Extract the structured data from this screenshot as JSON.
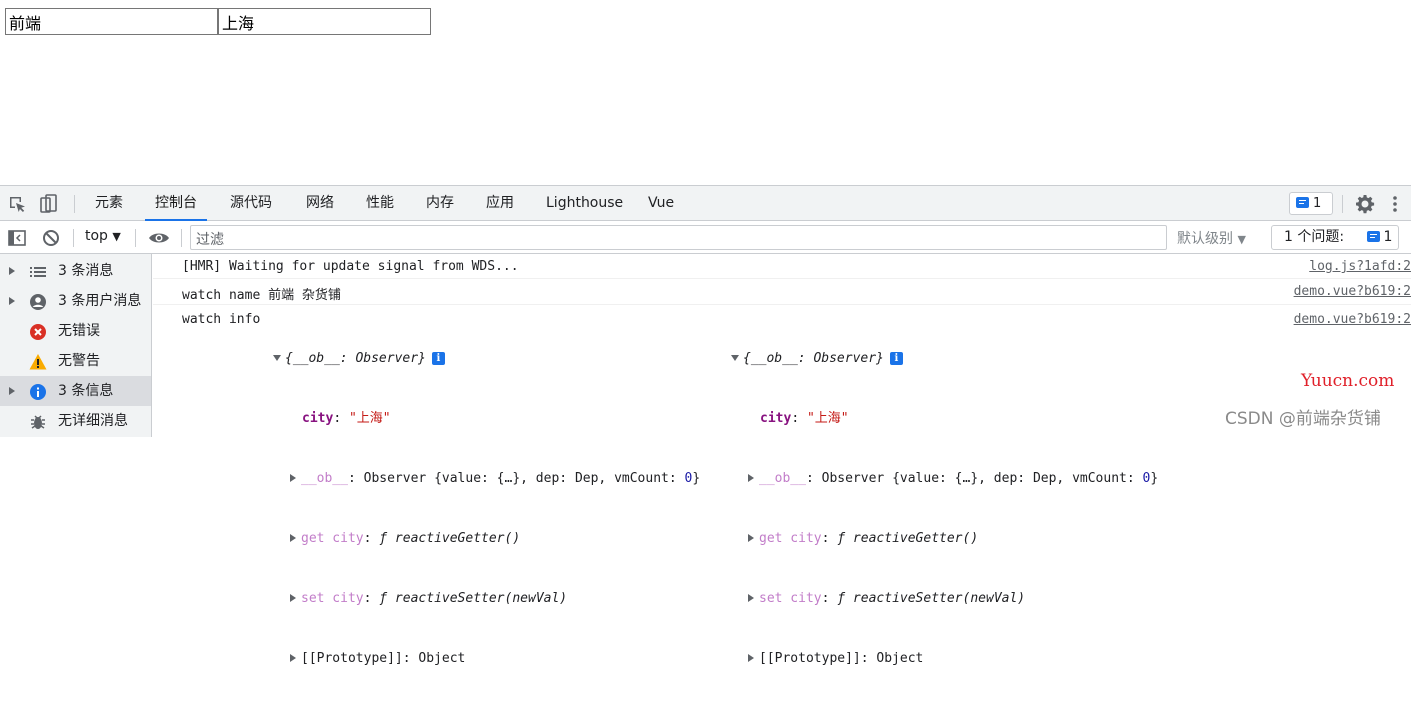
{
  "page": {
    "input1_value": "前端",
    "input2_value": "上海"
  },
  "devtools": {
    "tabs": [
      "元素",
      "控制台",
      "源代码",
      "网络",
      "性能",
      "内存",
      "应用",
      "Lighthouse",
      "Vue"
    ],
    "active_tab": "控制台",
    "issues_badge_count": "1",
    "context": "top",
    "filter_placeholder": "过滤",
    "levels_label": "默认级别",
    "issues_label": "1 个问题:",
    "issues_count": "1"
  },
  "sidebar": {
    "items": [
      {
        "label": "3 条消息",
        "icon": "list-icon"
      },
      {
        "label": "3 条用户消息",
        "icon": "user-icon"
      },
      {
        "label": "无错误",
        "icon": "error-icon"
      },
      {
        "label": "无警告",
        "icon": "warning-icon"
      },
      {
        "label": "3 条信息",
        "icon": "info-icon"
      },
      {
        "label": "无详细消息",
        "icon": "bug-icon"
      }
    ]
  },
  "console": {
    "messages": [
      {
        "text": "[HMR] Waiting for update signal from WDS...",
        "source": "log.js?1afd:2"
      },
      {
        "text": "watch name 前端 杂货铺",
        "source": "demo.vue?b619:2"
      },
      {
        "text": "watch info",
        "source": "demo.vue?b619:2"
      }
    ],
    "object": {
      "summary": "{__ob__: Observer}",
      "city_key": "city",
      "city_value": "\"上海\"",
      "ob_key": "__ob__",
      "ob_value_pre": "Observer {value: {…}, dep: Dep, vmCount: ",
      "ob_vmcount": "0",
      "ob_value_post": "}",
      "getter_key": "get city",
      "getter_value": "ƒ reactiveGetter()",
      "setter_key": "set city",
      "setter_value": "ƒ reactiveSetter(newVal)",
      "proto_key": "[[Prototype]]",
      "proto_value": "Object"
    }
  },
  "watermarks": {
    "site": "Yuucn.com",
    "csdn": "CSDN @前端杂货铺"
  },
  "colors": {
    "accent": "#1a73e8",
    "error": "#d93025",
    "warning": "#f9ab00",
    "string": "#c41a16",
    "key": "#881280"
  }
}
